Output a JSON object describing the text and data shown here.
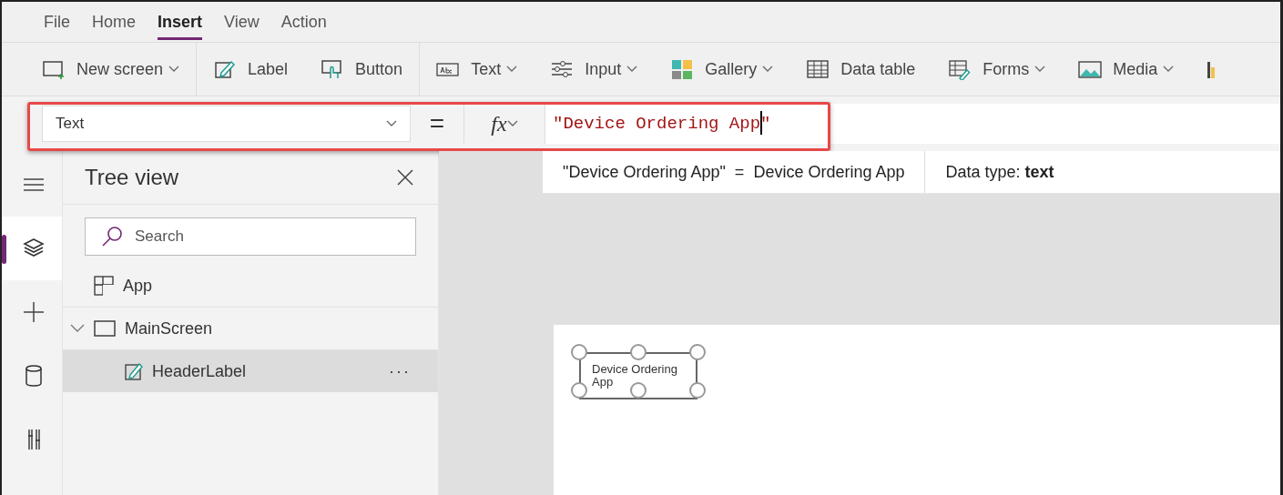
{
  "menu": [
    {
      "label": "File",
      "selected": false
    },
    {
      "label": "Home",
      "selected": false
    },
    {
      "label": "Insert",
      "selected": true
    },
    {
      "label": "View",
      "selected": false
    },
    {
      "label": "Action",
      "selected": false
    }
  ],
  "toolbar": [
    {
      "kind": "new-screen",
      "label": "New screen",
      "dropdown": true,
      "group_end": true
    },
    {
      "kind": "label",
      "label": "Label",
      "dropdown": false,
      "group_end": false
    },
    {
      "kind": "button",
      "label": "Button",
      "dropdown": false,
      "group_end": true
    },
    {
      "kind": "text",
      "label": "Text",
      "dropdown": true,
      "group_end": false
    },
    {
      "kind": "input",
      "label": "Input",
      "dropdown": true,
      "group_end": false
    },
    {
      "kind": "gallery",
      "label": "Gallery",
      "dropdown": true,
      "group_end": false
    },
    {
      "kind": "table",
      "label": "Data table",
      "dropdown": false,
      "group_end": false
    },
    {
      "kind": "forms",
      "label": "Forms",
      "dropdown": true,
      "group_end": false
    },
    {
      "kind": "media",
      "label": "Media",
      "dropdown": true,
      "group_end": false
    },
    {
      "kind": "chart",
      "dropdown": false,
      "group_end": false
    }
  ],
  "formula_bar": {
    "property": "Text",
    "operator": "=",
    "fx": "fx",
    "value": "\"Device Ordering App\"",
    "highlighted": true,
    "hint": "\"Device Ordering App\"  =  Device Ordering App",
    "data_type": "Data type: **text**"
  },
  "rail": [
    {
      "kind": "menu",
      "selected": false
    },
    {
      "kind": "layers",
      "selected": true
    },
    {
      "kind": "add",
      "selected": false
    },
    {
      "kind": "data",
      "selected": false
    },
    {
      "kind": "tools",
      "selected": false
    }
  ],
  "tree_view": {
    "title": "Tree view",
    "search": {
      "placeholder": "Search"
    },
    "items": [
      {
        "kind": "app",
        "label": "App",
        "selected": false
      },
      {
        "kind": "screen",
        "label": "MainScreen",
        "selected": false,
        "expanded": true,
        "children": [
          {
            "kind": "label",
            "label": "HeaderLabel",
            "selected": true,
            "more": "···"
          }
        ]
      }
    ]
  },
  "canvas": {
    "label": {
      "text": "Device Ordering App",
      "selected": true
    }
  }
}
